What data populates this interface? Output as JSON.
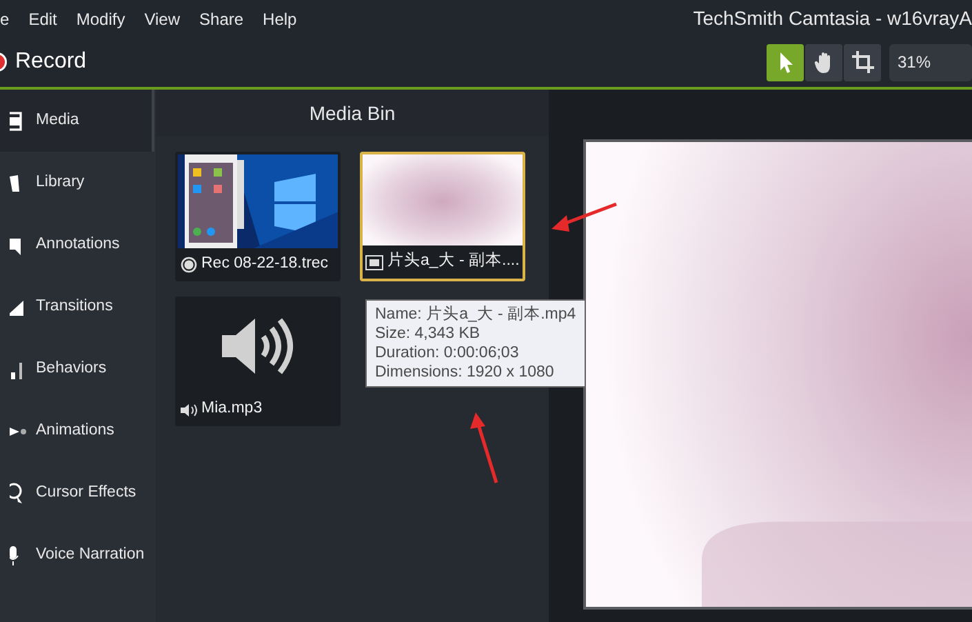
{
  "menu": [
    "e",
    "Edit",
    "Modify",
    "View",
    "Share",
    "Help"
  ],
  "window": {
    "title": "TechSmith Camtasia - w16vrayA"
  },
  "toolbar": {
    "record": "Record",
    "tools": [
      {
        "kind": "select",
        "selected": true
      },
      {
        "kind": "hand",
        "selected": false
      },
      {
        "kind": "crop",
        "selected": false
      }
    ],
    "zoom": "31%"
  },
  "sidebar": {
    "items": [
      {
        "label": "Media",
        "kind": "media",
        "selected": true
      },
      {
        "label": "Library",
        "kind": "library",
        "selected": false
      },
      {
        "label": "Annotations",
        "kind": "annotations",
        "selected": false
      },
      {
        "label": "Transitions",
        "kind": "transitions",
        "selected": false
      },
      {
        "label": "Behaviors",
        "kind": "behaviors",
        "selected": false
      },
      {
        "label": "Animations",
        "kind": "animations",
        "selected": false
      },
      {
        "label": "Cursor Effects",
        "kind": "cursor",
        "selected": false
      },
      {
        "label": "Voice Narration",
        "kind": "voice",
        "selected": false
      }
    ]
  },
  "media_bin": {
    "title": "Media Bin",
    "items": [
      {
        "name": "Rec 08-22-18.trec",
        "kind": "recording",
        "selected": false
      },
      {
        "name": "片头a_大 - 副本....",
        "kind": "video",
        "selected": true
      },
      {
        "name": "Mia.mp3",
        "kind": "audio",
        "selected": false
      }
    ],
    "tooltip": [
      "Name: 片头a_大 - 副本.mp4",
      "Size: 4,343 KB",
      "Duration: 0:00:06;03",
      "Dimensions: 1920 x 1080"
    ]
  }
}
